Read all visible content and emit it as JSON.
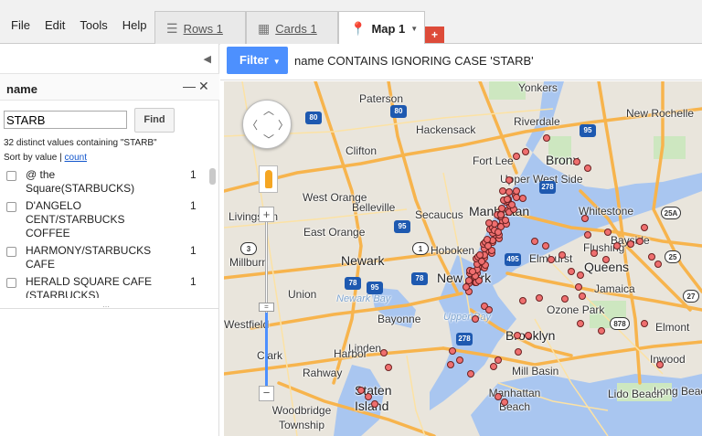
{
  "menu": [
    "File",
    "Edit",
    "Tools",
    "Help"
  ],
  "tabs": {
    "rows": {
      "label": "Rows 1",
      "icon": "rows-icon"
    },
    "cards": {
      "label": "Cards 1",
      "icon": "cards-icon"
    },
    "map": {
      "label": "Map 1",
      "icon": "map-pin-icon"
    },
    "add_label": "+"
  },
  "left_panel": {
    "collapse_glyph": "◀",
    "field_name": "name",
    "minimize_glyph": "—",
    "close_glyph": "✕",
    "search_value": "STARB",
    "find_label": "Find",
    "distinct_summary": "32 distinct values containing \"STARB\"",
    "sort_prefix": "Sort by value | ",
    "sort_link": "count",
    "values": [
      {
        "label": "@ the Square(STARBUCKS)",
        "count": "1"
      },
      {
        "label": "D'ANGELO CENT/STARBUCKS COFFEE",
        "count": "1"
      },
      {
        "label": "HARMONY/STARBUCKS CAFE",
        "count": "1"
      },
      {
        "label": "HERALD SQUARE CAFE (STARBUCKS)",
        "count": "1"
      }
    ],
    "grip": "⋯"
  },
  "filter": {
    "button_label": "Filter",
    "expression": "name CONTAINS IGNORING CASE 'STARB'"
  },
  "map": {
    "places": [
      {
        "text": "Yonkers",
        "cls": ""
      },
      {
        "text": "Paterson",
        "cls": ""
      },
      {
        "text": "Hackensack",
        "cls": ""
      },
      {
        "text": "New Rochelle",
        "cls": ""
      },
      {
        "text": "Riverdale",
        "cls": ""
      },
      {
        "text": "Clifton",
        "cls": ""
      },
      {
        "text": "Fort Lee",
        "cls": ""
      },
      {
        "text": "Bronx",
        "cls": "big"
      },
      {
        "text": "Upper West Side",
        "cls": ""
      },
      {
        "text": "West Orange",
        "cls": ""
      },
      {
        "text": "Belleville",
        "cls": ""
      },
      {
        "text": "Livingston",
        "cls": ""
      },
      {
        "text": "Secaucus",
        "cls": ""
      },
      {
        "text": "Manhattan",
        "cls": "big"
      },
      {
        "text": "Whitestone",
        "cls": ""
      },
      {
        "text": "East Orange",
        "cls": ""
      },
      {
        "text": "Flushing",
        "cls": ""
      },
      {
        "text": "Bayside",
        "cls": ""
      },
      {
        "text": "Hoboken",
        "cls": ""
      },
      {
        "text": "Newark",
        "cls": "big"
      },
      {
        "text": "Elmhurst",
        "cls": ""
      },
      {
        "text": "Queens",
        "cls": "big"
      },
      {
        "text": "Millburn",
        "cls": ""
      },
      {
        "text": "New York",
        "cls": "big"
      },
      {
        "text": "Union",
        "cls": ""
      },
      {
        "text": "Newark Bay",
        "cls": "water"
      },
      {
        "text": "Jamaica",
        "cls": ""
      },
      {
        "text": "Westfield",
        "cls": ""
      },
      {
        "text": "Bayonne",
        "cls": ""
      },
      {
        "text": "Upper Bay",
        "cls": "water"
      },
      {
        "text": "Ozone Park",
        "cls": ""
      },
      {
        "text": "Brooklyn",
        "cls": "big"
      },
      {
        "text": "Elmont",
        "cls": ""
      },
      {
        "text": "Linden",
        "cls": ""
      },
      {
        "text": "Clark",
        "cls": ""
      },
      {
        "text": "Harbor",
        "cls": ""
      },
      {
        "text": "Inwood",
        "cls": ""
      },
      {
        "text": "Rahway",
        "cls": ""
      },
      {
        "text": "Mill Basin",
        "cls": ""
      },
      {
        "text": "Staten Island",
        "cls": "big"
      },
      {
        "text": "Woodbridge Township",
        "cls": ""
      },
      {
        "text": "Manhattan Beach",
        "cls": ""
      },
      {
        "text": "Long Beach",
        "cls": ""
      },
      {
        "text": "Lido Beach",
        "cls": ""
      }
    ],
    "shields": [
      {
        "text": "80",
        "cls": "i"
      },
      {
        "text": "80",
        "cls": "i"
      },
      {
        "text": "95",
        "cls": "i"
      },
      {
        "text": "95",
        "cls": "i"
      },
      {
        "text": "278",
        "cls": "i"
      },
      {
        "text": "78",
        "cls": "i"
      },
      {
        "text": "495",
        "cls": "i"
      },
      {
        "text": "278",
        "cls": "i"
      },
      {
        "text": "95",
        "cls": "i"
      },
      {
        "text": "78",
        "cls": "i"
      },
      {
        "text": "25A",
        "cls": "s"
      },
      {
        "text": "25",
        "cls": "s"
      },
      {
        "text": "878",
        "cls": "s"
      },
      {
        "text": "27",
        "cls": "s"
      },
      {
        "text": "1",
        "cls": "s"
      },
      {
        "text": "3",
        "cls": "s"
      }
    ],
    "marker_color": "#ef6f6f",
    "zoom_in": "+",
    "zoom_out": "−"
  }
}
